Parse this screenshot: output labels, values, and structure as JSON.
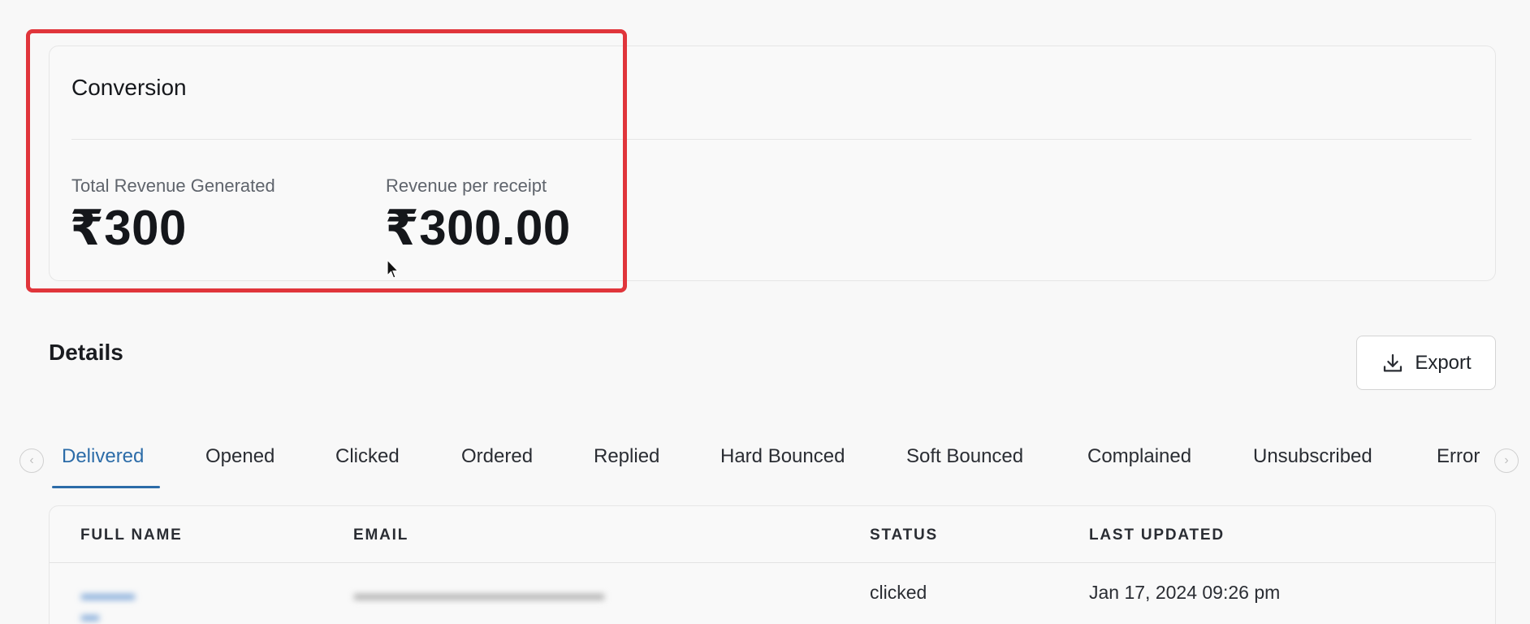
{
  "conversion": {
    "title": "Conversion",
    "metrics": [
      {
        "label": "Total Revenue Generated",
        "value": "₹300"
      },
      {
        "label": "Revenue per receipt",
        "value": "₹300.00"
      }
    ]
  },
  "details": {
    "title": "Details",
    "export_label": "Export",
    "tabs": [
      "Delivered",
      "Opened",
      "Clicked",
      "Ordered",
      "Replied",
      "Hard Bounced",
      "Soft Bounced",
      "Complained",
      "Unsubscribed",
      "Error"
    ],
    "active_tab": "Delivered",
    "table": {
      "columns": [
        "FULL NAME",
        "EMAIL",
        "STATUS",
        "LAST UPDATED"
      ],
      "rows": [
        {
          "full_name": "",
          "email": "",
          "status": "clicked",
          "last_updated": "Jan 17, 2024 09:26 pm"
        }
      ]
    }
  },
  "colors": {
    "accent": "#2c6ca8",
    "highlight": "#e0353b",
    "background": "#f8f8f8"
  },
  "icons": {
    "export": "download-icon",
    "tab_prev": "arrow-left-circle-icon",
    "tab_next": "arrow-right-circle-icon",
    "cursor": "mouse-pointer-icon"
  }
}
